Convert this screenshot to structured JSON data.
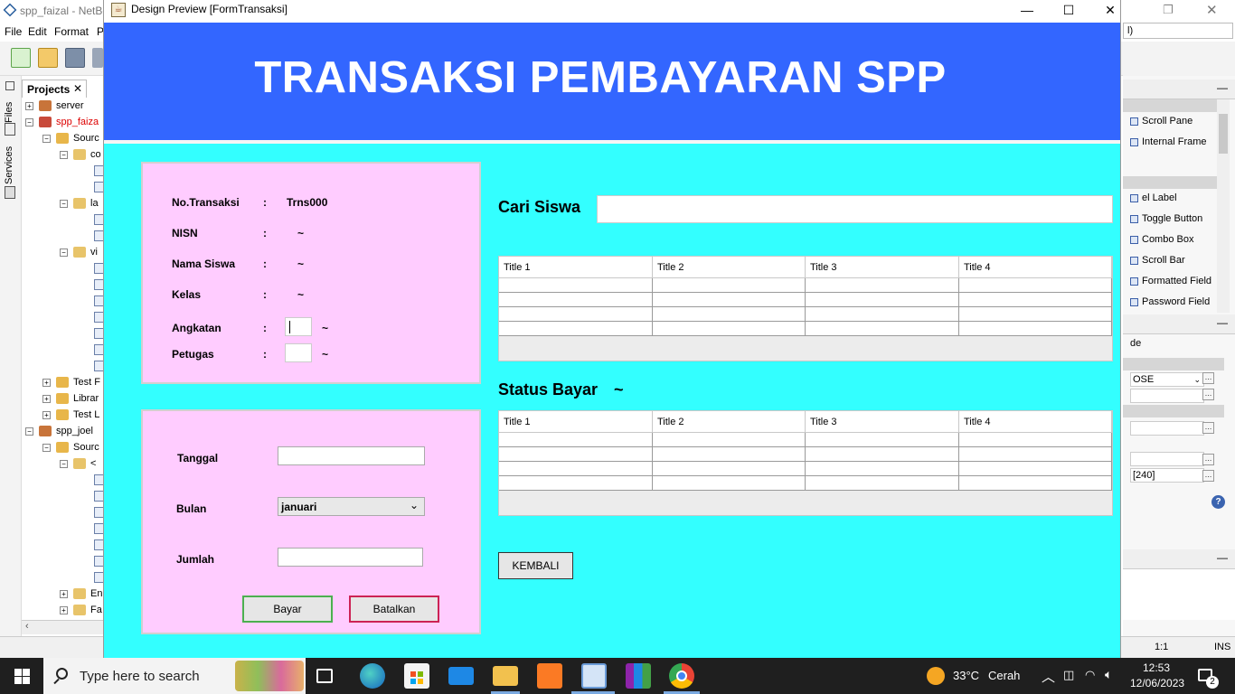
{
  "ide": {
    "title": "spp_faizal - NetBe",
    "menus": [
      "File",
      "Edit",
      "Format",
      "P"
    ],
    "side_tabs": [
      "Files",
      "Services"
    ],
    "projects_tab": "Projects",
    "tree": [
      {
        "label": "server",
        "indent": 0
      },
      {
        "label": "spp_faiza",
        "indent": 0
      },
      {
        "label": "Sourc",
        "indent": 1
      },
      {
        "label": "co",
        "indent": 2
      },
      {
        "label": "la",
        "indent": 2
      },
      {
        "label": "vi",
        "indent": 2
      },
      {
        "label": "Test F",
        "indent": 1
      },
      {
        "label": "Librar",
        "indent": 1
      },
      {
        "label": "Test L",
        "indent": 1
      },
      {
        "label": "spp_joel",
        "indent": 0
      },
      {
        "label": "Sourc",
        "indent": 1
      },
      {
        "label": "<",
        "indent": 2
      },
      {
        "label": "En",
        "indent": 2
      },
      {
        "label": "Fa",
        "indent": 2
      }
    ],
    "palette_items": [
      "Scroll Pane",
      "Internal Frame",
      "el Label",
      "Toggle Button",
      "Combo Box",
      "Scroll Bar",
      "Formatted Field",
      "Password Field"
    ],
    "properties": {
      "code_label": "de",
      "close_value": "OSE",
      "size_value": "[240]",
      "help_icon": "?"
    },
    "right_top_field": "l)",
    "status": {
      "position": "1:1",
      "mode": "INS"
    }
  },
  "window": {
    "title": "Design Preview [FormTransaksi]",
    "controls": {
      "minimize": "—",
      "maximize": "☐",
      "close": "✕"
    }
  },
  "header": {
    "title": "TRANSAKSI PEMBAYARAN SPP"
  },
  "info": {
    "colon": ":",
    "no_transaksi_label": "No.Transaksi",
    "no_transaksi_value": "Trns000",
    "nisn_label": "NISN",
    "nisn_value": "~",
    "nama_label": "Nama Siswa",
    "nama_value": "~",
    "kelas_label": "Kelas",
    "kelas_value": "~",
    "angkatan_label": "Angkatan",
    "angkatan_value": "~",
    "petugas_label": "Petugas",
    "petugas_value": "~"
  },
  "payment": {
    "tanggal_label": "Tanggal",
    "bulan_label": "Bulan",
    "bulan_selected": "januari",
    "jumlah_label": "Jumlah",
    "bayar_label": "Bayar",
    "batalkan_label": "Batalkan"
  },
  "search": {
    "label": "Cari Siswa",
    "value": ""
  },
  "table1": {
    "columns": [
      "Title 1",
      "Title 2",
      "Title 3",
      "Title 4"
    ],
    "row_count": 4
  },
  "status_bayar": {
    "label": "Status Bayar",
    "value": "~"
  },
  "table2": {
    "columns": [
      "Title 1",
      "Title 2",
      "Title 3",
      "Title 4"
    ],
    "row_count": 4
  },
  "kembali_label": "KEMBALI",
  "taskbar": {
    "search_placeholder": "Type here to search",
    "weather_temp": "33°C",
    "weather_text": "Cerah",
    "time": "12:53",
    "date": "12/06/2023",
    "notification_count": "2"
  },
  "colors": {
    "header": "#3366ff",
    "background": "#33ffff",
    "panel": "#ffccff",
    "bayar_border": "#4caf50",
    "batalkan_border": "#cc2255"
  }
}
